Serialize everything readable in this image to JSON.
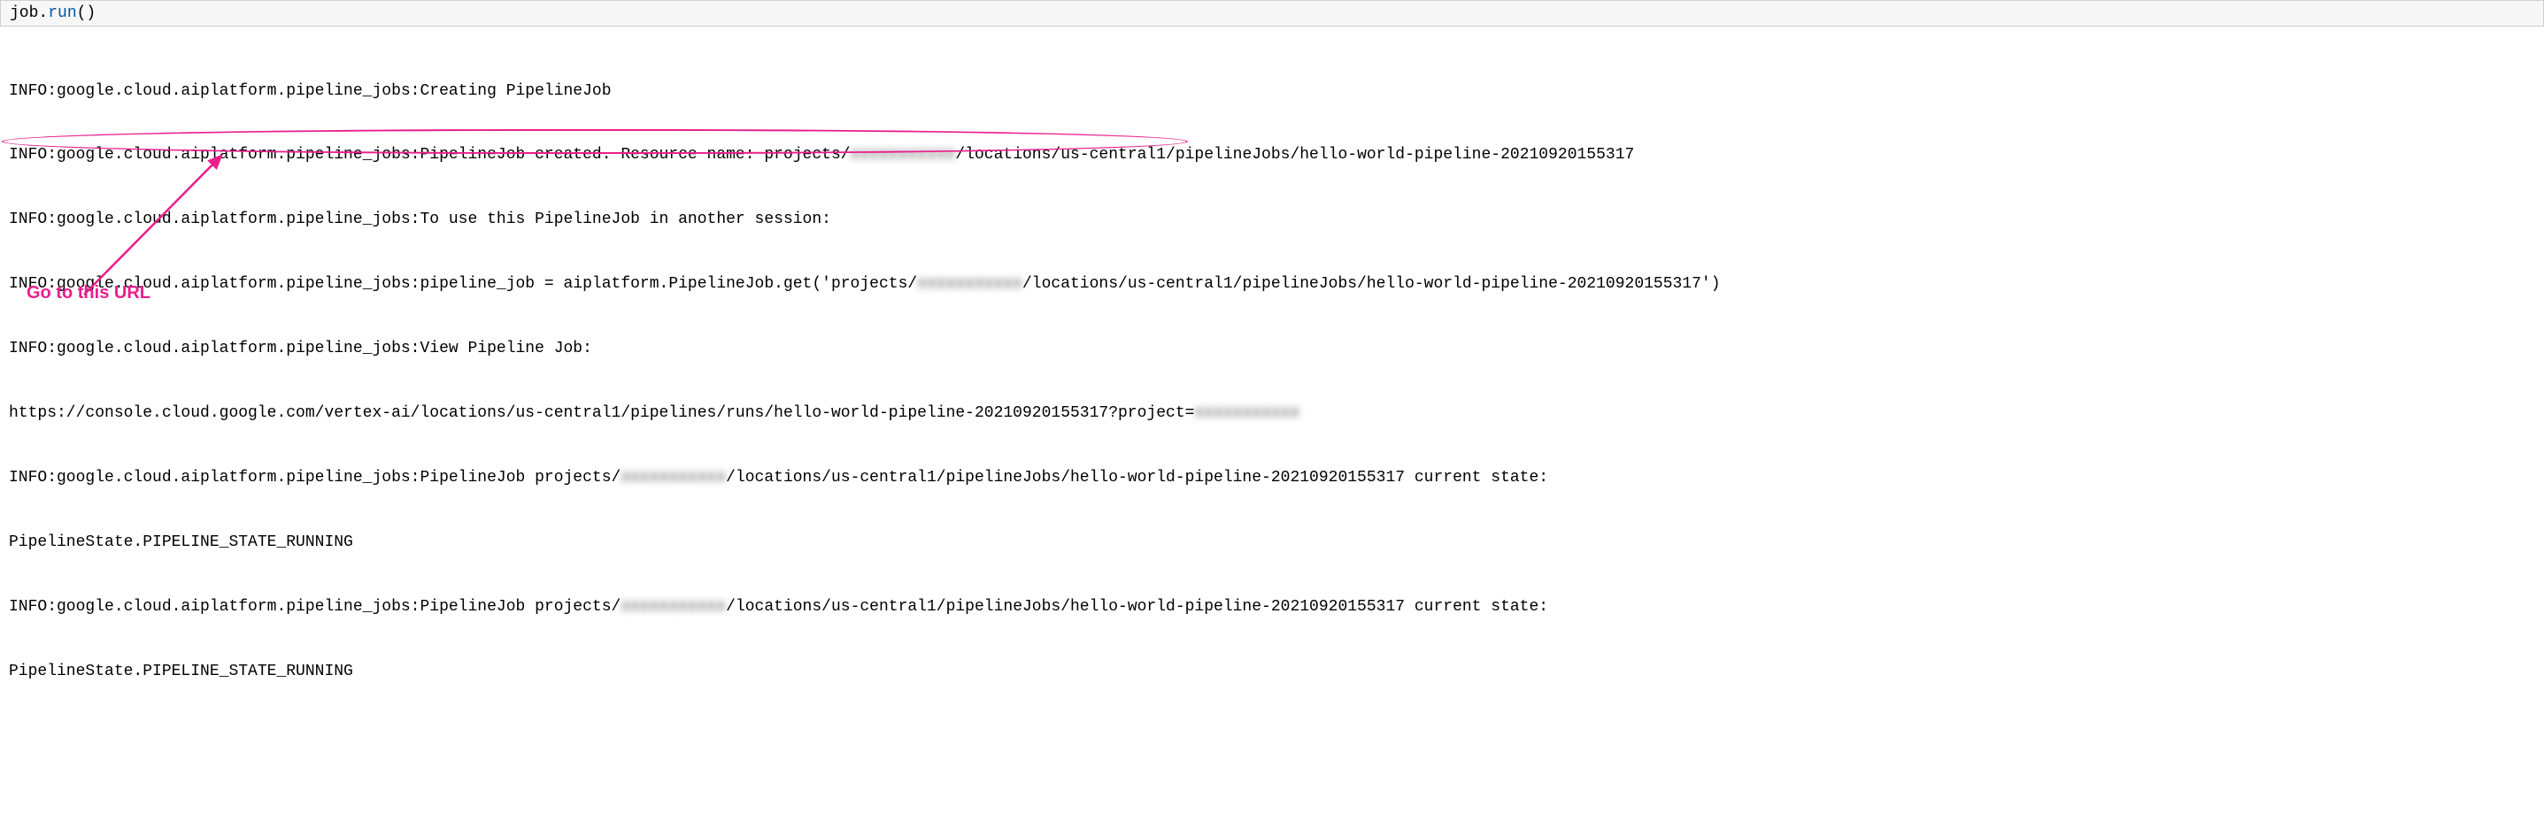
{
  "code": {
    "object": "job",
    "dot": ".",
    "method": "run",
    "parens": "()"
  },
  "output": {
    "line1": "INFO:google.cloud.aiplatform.pipeline_jobs:Creating PipelineJob",
    "line2_a": "INFO:google.cloud.aiplatform.pipeline_jobs:PipelineJob created. Resource name: projects/",
    "line2_blur": "xxxxxxxxxxx",
    "line2_b": "/locations/us-central1/pipelineJobs/hello-world-pipeline-20210920155317",
    "line3": "INFO:google.cloud.aiplatform.pipeline_jobs:To use this PipelineJob in another session:",
    "line4_a": "INFO:google.cloud.aiplatform.pipeline_jobs:pipeline_job = aiplatform.PipelineJob.get('projects/",
    "line4_blur": "xxxxxxxxxxx",
    "line4_b": "/locations/us-central1/pipelineJobs/hello-world-pipeline-20210920155317')",
    "line5": "INFO:google.cloud.aiplatform.pipeline_jobs:View Pipeline Job:",
    "line6_a": "https://console.cloud.google.com/vertex-ai/locations/us-central1/pipelines/runs/hello-world-pipeline-20210920155317?project=",
    "line6_blur": "xxxxxxxxxxx",
    "line7_a": "INFO:google.cloud.aiplatform.pipeline_jobs:PipelineJob projects/",
    "line7_blur": "xxxxxxxxxxx",
    "line7_b": "/locations/us-central1/pipelineJobs/hello-world-pipeline-20210920155317 current state:",
    "line8": "PipelineState.PIPELINE_STATE_RUNNING",
    "line9_a": "INFO:google.cloud.aiplatform.pipeline_jobs:PipelineJob projects/",
    "line9_blur": "xxxxxxxxxxx",
    "line9_b": "/locations/us-central1/pipelineJobs/hello-world-pipeline-20210920155317 current state:",
    "line10": "PipelineState.PIPELINE_STATE_RUNNING"
  },
  "annotation": {
    "label": "Go to this URL"
  }
}
